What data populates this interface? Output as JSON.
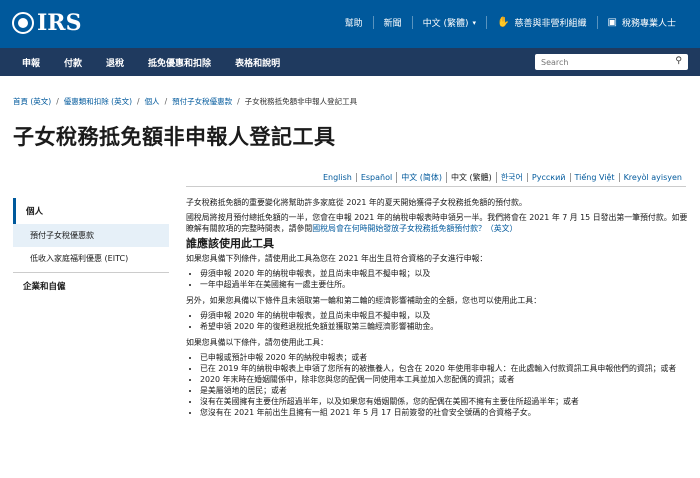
{
  "brand": {
    "logo_text": "IRS"
  },
  "utility": {
    "help": "幫助",
    "news": "新聞",
    "language": "中文 (繁體)",
    "charities": "慈善與非營利組織",
    "tax_pros": "稅務專業人士"
  },
  "nav": {
    "items": [
      "申報",
      "付款",
      "退稅",
      "抵免優惠和扣除",
      "表格和說明"
    ]
  },
  "search": {
    "placeholder": "Search"
  },
  "breadcrumb": {
    "items": [
      "首頁 (英文)",
      "優惠類和扣除 (英文)",
      "個人",
      "預付子女稅優惠款"
    ],
    "current": "子女稅務抵免額非申報人登記工具"
  },
  "page": {
    "title": "子女稅務抵免額非申報人登記工具"
  },
  "languages": {
    "items": [
      "English",
      "Español",
      "中文 (简体)",
      "中文 (繁體)",
      "한국어",
      "Русский",
      "Tiếng Việt",
      "Kreyòl ayisyen"
    ],
    "current": "中文 (繁體)"
  },
  "sidebar": {
    "section": "個人",
    "items": [
      "預付子女稅優惠款",
      "低收入家庭福利優惠 (EITC)"
    ],
    "selected": "預付子女稅優惠款",
    "group2": "企業和自僱"
  },
  "content": {
    "p1": "子女稅務抵免額的重要變化將幫助許多家庭從 2021 年的夏天開始獲得子女稅務抵免額的預付款。",
    "p2a": "國稅局將按月預付總抵免額的一半，您會在申報 2021 年的納稅申報表時申領另一半。我們將會在 2021 年 7 月 15 日發出第一筆預付款。如要瞭解有關款項的完整時間表，請參閱",
    "p2link": "國稅局會在何時開始發放子女稅務抵免額預付款？（英文）",
    "h2": "誰應該使用此工具",
    "p3": "如果您具備下列條件，請使用此工具為您在 2021 年出生且符合資格的子女進行申報：",
    "list1": [
      "毋須申報 2020 年的納稅申報表，並且尚未申報且不擬申報；以及",
      "一年中超過半年在美國擁有一處主要住所。"
    ],
    "p4": "另外，如果您具備以下條件且未領取第一輪和第二輪的經濟影響補助金的全額，您也可以使用此工具：",
    "list2": [
      "毋須申報 2020 年的納稅申報表，並且尚未申報且不擬申報，以及",
      "希望申領 2020 年的復甦退稅抵免額並獲取第三輪經濟影響補助金。"
    ],
    "p5": "如果您具備以下條件，請勿使用此工具：",
    "list3": [
      "已申報或預計申報 2020 年的納稅申報表；或者",
      "已在 2019 年的納稅申報表上申領了您所有的被撫養人，包含在 2020 年使用非申報人：在此處輸入付款資訊工具申報他們的資訊；或者",
      "2020 年末時在婚姻關係中，除非您與您的配偶一同使用本工具並加入您配偶的資訊；或者",
      "是美屬領地的居民；或者",
      "沒有在美國擁有主要住所超過半年，以及如果您有婚姻關係，您的配偶在美國不擁有主要住所超過半年；或者",
      "您沒有在 2021 年前出生且擁有一組 2021 年 5 月 17 日前簽發的社會安全號碼的合資格子女。"
    ]
  }
}
